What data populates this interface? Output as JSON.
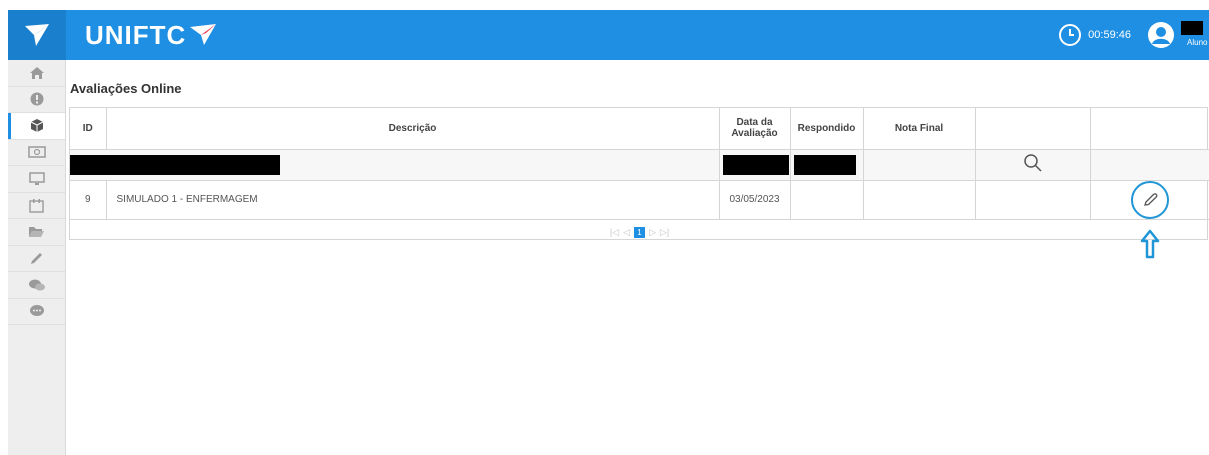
{
  "header": {
    "brand": "UNIFTC",
    "timer": "00:59:46",
    "user_role": "Aluno"
  },
  "sidebar": {
    "items": [
      {
        "icon": "home-icon"
      },
      {
        "icon": "alert-icon"
      },
      {
        "icon": "cube-icon",
        "active": true
      },
      {
        "icon": "money-icon"
      },
      {
        "icon": "monitor-icon"
      },
      {
        "icon": "calendar-icon"
      },
      {
        "icon": "folder-open-icon"
      },
      {
        "icon": "pencil-icon"
      },
      {
        "icon": "chat-bubbles-icon"
      },
      {
        "icon": "comment-dots-icon"
      }
    ]
  },
  "page": {
    "title": "Avaliações Online"
  },
  "table": {
    "headers": {
      "id": "ID",
      "descricao": "Descrição",
      "data_line1": "Data da",
      "data_line2": "Avaliação",
      "respondido": "Respondido",
      "nota": "Nota Final"
    },
    "rows": [
      {
        "id": "9",
        "descricao": "SIMULADO 1 - ENFERMAGEM",
        "data": "03/05/2023",
        "respondido": "",
        "nota": ""
      }
    ],
    "pager": {
      "current_page": "1"
    }
  },
  "colors": {
    "header_blue": "#1e8fe3",
    "logo_box_blue": "#1a7fcc",
    "logo_accent_red": "#e8334a",
    "highlight_blue": "#2196d6"
  }
}
